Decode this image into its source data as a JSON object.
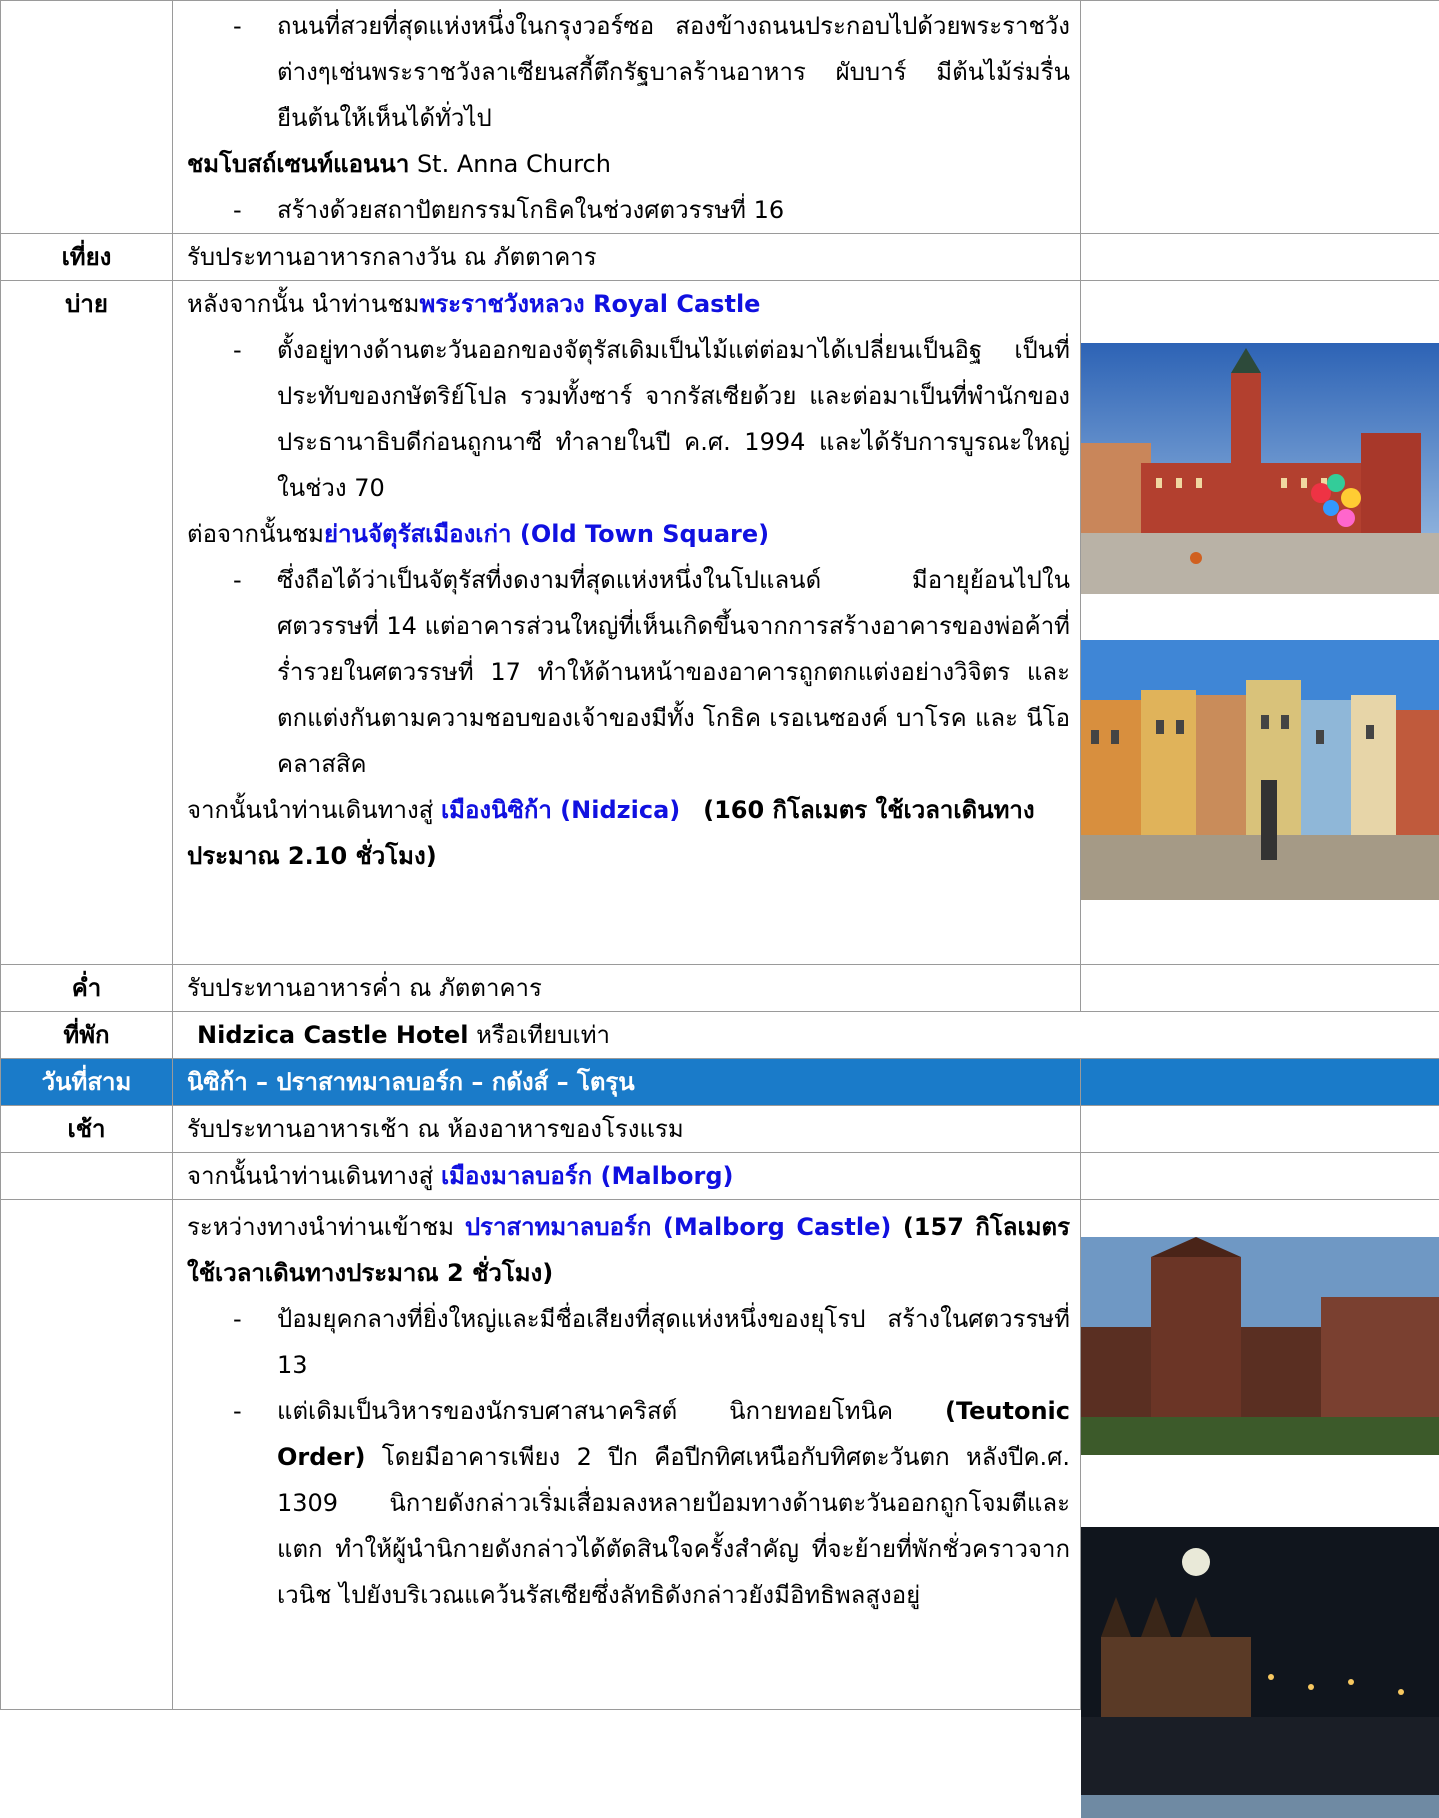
{
  "rows": {
    "r1": {
      "label": "",
      "b1": "ถนนที่สวยที่สุดแห่งหนึ่งในกรุงวอร์ซอ สองข้างถนนประกอบไปด้วยพระราชวังต่างๆเช่นพระราชวังลาเซียนสกี้ตึกรัฐบาลร้านอาหาร ผับบาร์ มีต้นไม้ร่มรื่นยืนต้นให้เห็นได้ทั่วไป",
      "church_bold": "ชมโบสถ์เซนท์แอนนา",
      "church_en": " St. Anna Church",
      "b2": "สร้างด้วยสถาปัตยกรรมโกธิคในช่วงศตวรรษที่ 16"
    },
    "r2": {
      "label": "เที่ยง",
      "text": "รับประทานอาหารกลางวัน ณ ภัตตาคาร"
    },
    "r3": {
      "label": "บ่าย",
      "intro": "หลังจากนั้น นำท่านชม",
      "castle": "พระราชวังหลวง Royal Castle",
      "b1": "ตั้งอยู่ทางด้านตะวันออกของจัตุรัสเดิมเป็นไม้แต่ต่อมาได้เปลี่ยนเป็นอิฐ เป็นที่ประทับของกษัตริย์โปล รวมทั้งซาร์ จากรัสเซียด้วย และต่อมาเป็นที่พำนักของประธานาธิบดีก่อนถูกนาซี ทำลายในปี ค.ศ. 1994 และได้รับการบูรณะใหญ่ในช่วง 70",
      "intro2": "ต่อจากนั้นชม",
      "square": "ย่านจัตุรัสเมืองเก่า (Old Town Square)",
      "b2": "ซึ่งถือได้ว่าเป็นจัตุรัสที่งดงามที่สุดแห่งหนึ่งในโปแลนด์ มีอายุย้อนไปในศตวรรษที่ 14 แต่อาคารส่วนใหญ่ที่เห็นเกิดขึ้นจากการสร้างอาคารของพ่อค้าที่ร่ำรวยในศตวรรษที่ 17 ทำให้ด้านหน้าของอาคารถูกตกแต่งอย่างวิจิตร และตกแต่งกันตามความชอบของเจ้าของมีทั้ง โกธิค เรอเนซองค์ บาโรค และ นีโอคลาสสิค",
      "travel_intro": "จากนั้นนำท่านเดินทางสู่ ",
      "nidzica": "เมืองนิซิก้า (Nidzica)",
      "travel_note": "(160 กิโลเมตร ใช้เวลาเดินทางประมาณ 2.10 ชั่วโมง)"
    },
    "r4": {
      "label": "ค่ำ",
      "text": "รับประทานอาหารค่ำ ณ ภัตตาคาร"
    },
    "r5": {
      "label": "ที่พัก",
      "hotel": "Nidzica Castle Hotel",
      "hotel_suffix": " หรือเทียบเท่า"
    },
    "r6": {
      "label": "วันที่สาม",
      "text": "นิซิก้า – ปราสาทมาลบอร์ก – กดังส์ – โตรุน"
    },
    "r7": {
      "label": "เช้า",
      "text": "รับประทานอาหารเช้า ณ ห้องอาหารของโรงแรม"
    },
    "r8": {
      "label": "",
      "intro": "จากนั้นนำท่านเดินทางสู่ ",
      "malborg": "เมืองมาลบอร์ก (Malborg)"
    },
    "r9": {
      "label": "",
      "intro": "ระหว่างทางนำท่านเข้าชม ",
      "castle": "ปราสาทมาลบอร์ก (Malborg Castle)",
      "note": " (157 กิโลเมตร ใช้เวลาเดินทางประมาณ 2 ชั่วโมง)",
      "b1": "ป้อมยุคกลางที่ยิ่งใหญ่และมีชื่อเสียงที่สุดแห่งหนึ่งของยุโรป สร้างในศตวรรษที่ 13",
      "b2_pre": "แต่เดิมเป็นวิหารของนักรบศาสนาคริสต์ นิกายทอยโทนิค ",
      "b2_bold": "(Teutonic Order)",
      "b2_post": " โดยมีอาคารเพียง 2 ปีก คือปีกทิศเหนือกับทิศตะวันตก หลังปีค.ศ. 1309 นิกายดังกล่าวเริ่มเสื่อมลงหลายป้อมทางด้านตะวันออกถูกโจมตีและแตก ทำให้ผู้นำนิกายดังกล่าวได้ตัดสินใจครั้งสำคัญ ที่จะย้ายที่พักชั่วคราวจากเวนิช ไปยังบริเวณแคว้นรัสเซียซึ่งลัทธิดังกล่าวยังมีอิทธิพลสูงอยู่"
    }
  },
  "dash": "-",
  "colors": {
    "header_bg": "#1a7bc9",
    "link": "#1010e0",
    "border": "#9a9a9a"
  },
  "photos": [
    "royal-castle-photo",
    "old-town-square-photo",
    "malbork-castle-day-photo",
    "malbork-castle-night-photo"
  ]
}
